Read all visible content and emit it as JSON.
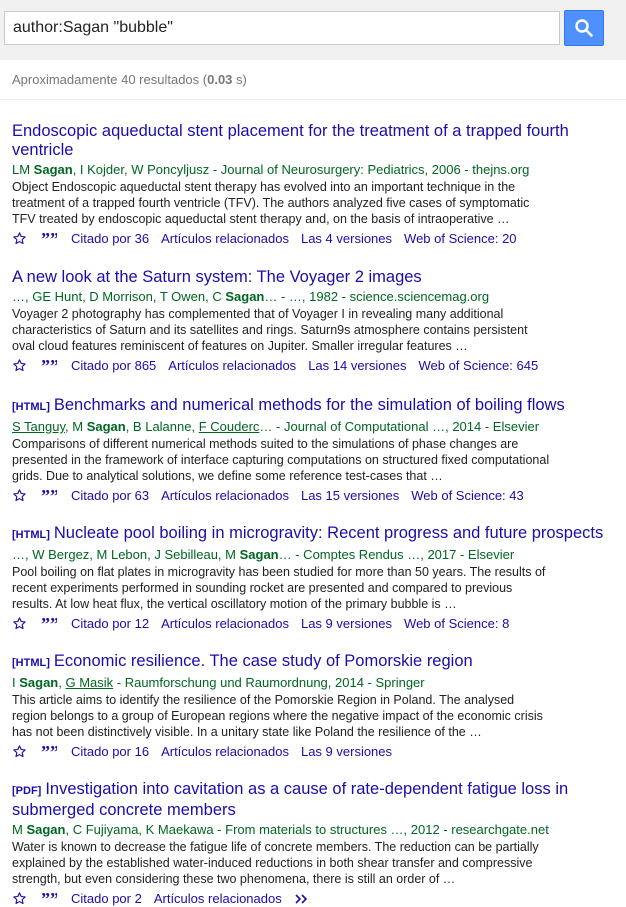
{
  "search": {
    "query": "author:Sagan \"bubble\""
  },
  "stats": {
    "prefix": "Aproximadamente 40 resultados (",
    "time": "0.03",
    "suffix": " s)"
  },
  "results": [
    {
      "tag": "",
      "title": "Endoscopic aqueductal stent placement for the treatment of a trapped fourth ventricle",
      "authors_html": "LM <b>Sagan</b>, I Kojder, W Poncyljusz - Journal of Neurosurgery: Pediatrics, 2006 - thejns.org",
      "snippet": "Object Endoscopic aqueductal stent therapy has evolved into an important technique in the treatment of a trapped fourth ventricle (TFV). The authors analyzed five cases of symptomatic TFV treated by endoscopic aqueductal stent therapy and, on the basis of intraoperative …",
      "cited": "Citado por 36",
      "related": "Artículos relacionados",
      "versions": "Las 4 versiones",
      "wos": "Web of Science: 20"
    },
    {
      "tag": "",
      "title": "A new look at the Saturn system: The Voyager 2 images",
      "authors_html": "…, GE Hunt, D Morrison, T Owen, C <b>Sagan</b>… - …, 1982 - science.sciencemag.org",
      "snippet": "Voyager 2 photography has complemented that of Voyager I in revealing many additional characteristics of Saturn and its satellites and rings. Saturn9s atmosphere contains persistent oval cloud features reminiscent of features on Jupiter. Smaller irregular features …",
      "cited": "Citado por 865",
      "related": "Artículos relacionados",
      "versions": "Las 14 versiones",
      "wos": "Web of Science: 645"
    },
    {
      "tag": "[HTML]",
      "title": "Benchmarks and numerical methods for the simulation of boiling flows",
      "authors_html": "<u>S Tanguy</u>, M <b>Sagan</b>, B Lalanne, <u>F Couderc</u>… - Journal of Computational …, 2014 - Elsevier",
      "snippet": "Comparisons of different numerical methods suited to the simulations of phase changes are presented in the framework of interface capturing computations on structured fixed computational grids. Due to analytical solutions, we define some reference test-cases that …",
      "cited": "Citado por 63",
      "related": "Artículos relacionados",
      "versions": "Las 15 versiones",
      "wos": "Web of Science: 43"
    },
    {
      "tag": "[HTML]",
      "title": "Nucleate pool boiling in microgravity: Recent progress and future prospects",
      "authors_html": "…, W Bergez, M Lebon, J Sebilleau, M <b>Sagan</b>… - Comptes Rendus …, 2017 - Elsevier",
      "snippet": "Pool boiling on flat plates in microgravity has been studied for more than 50 years. The results of recent experiments performed in sounding rocket are presented and compared to previous results. At low heat flux, the vertical oscillatory motion of the primary bubble is …",
      "cited": "Citado por 12",
      "related": "Artículos relacionados",
      "versions": "Las 9 versiones",
      "wos": "Web of Science: 8"
    },
    {
      "tag": "[HTML]",
      "title": "Economic resilience. The case study of Pomorskie region",
      "authors_html": "I <b>Sagan</b>, <u>G Masik</u> - Raumforschung und Raumordnung, 2014 - Springer",
      "snippet": "This article aims to identify the resilience of the Pomorskie Region in Poland. The analysed region belongs to a group of European regions where the negative impact of the economic crisis has not been distinctively visible. In a unitary state like Poland the resilience of the …",
      "cited": "Citado por 16",
      "related": "Artículos relacionados",
      "versions": "Las 9 versiones",
      "wos": ""
    },
    {
      "tag": "[PDF]",
      "title": "Investigation into cavitation as a cause of rate-dependent fatigue loss in submerged concrete members",
      "authors_html": "M <b>Sagan</b>, C Fujiyama, K Maekawa - From materials to structures …, 2012 - researchgate.net",
      "snippet": "Water is known to decrease the fatigue life of concrete members. The reduction can be partially explained by the established water-induced reductions in both shear transfer and compressive strength, but even considering these two phenomena, there is still an order of …",
      "cited": "Citado por 2",
      "related": "Artículos relacionados",
      "versions": "",
      "wos": "",
      "more": "»"
    }
  ]
}
